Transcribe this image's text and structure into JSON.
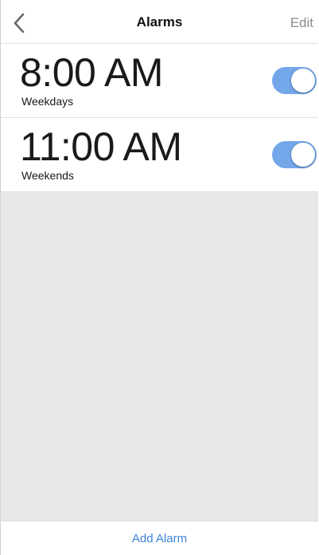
{
  "navbar": {
    "title": "Alarms",
    "edit_label": "Edit",
    "back_icon": "chevron-left-icon"
  },
  "alarms": [
    {
      "time": "8:00 AM",
      "days": "Weekdays",
      "enabled": true
    },
    {
      "time": "11:00 AM",
      "days": "Weekends",
      "enabled": true
    }
  ],
  "footer": {
    "add_label": "Add Alarm"
  },
  "colors": {
    "accent": "#3d83d8",
    "toggle_on": "#74a7ea",
    "empty_area": "#e8e8e8",
    "edit_text": "#8c8c8c"
  }
}
